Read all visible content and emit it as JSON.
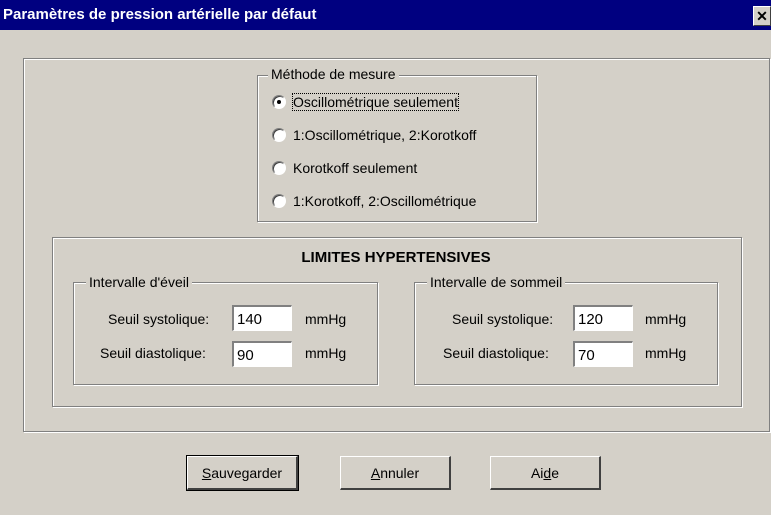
{
  "window": {
    "title": "Paramètres de pression artérielle par défaut",
    "close_label": "✕"
  },
  "method_group": {
    "legend": "Méthode de mesure",
    "options": [
      {
        "label": "Oscillométrique seulement",
        "selected": true
      },
      {
        "label": "1:Oscillométrique, 2:Korotkoff",
        "selected": false
      },
      {
        "label": "Korotkoff seulement",
        "selected": false
      },
      {
        "label": "1:Korotkoff, 2:Oscillométrique",
        "selected": false
      }
    ]
  },
  "limits": {
    "title": "LIMITES HYPERTENSIVES",
    "awake": {
      "legend": "Intervalle d'éveil",
      "systolic_label": "Seuil systolique:",
      "systolic_value": "140",
      "diastolic_label": "Seuil diastolique:",
      "diastolic_value": "90",
      "unit": "mmHg"
    },
    "sleep": {
      "legend": "Intervalle de sommeil",
      "systolic_label": "Seuil systolique:",
      "systolic_value": "120",
      "diastolic_label": "Seuil diastolique:",
      "diastolic_value": "70",
      "unit": "mmHg"
    }
  },
  "buttons": {
    "save": {
      "mnemonic": "S",
      "rest": "auvegarder"
    },
    "cancel": {
      "mnemonic": "A",
      "rest": "nnuler"
    },
    "help": {
      "pre": "Ai",
      "mnemonic": "d",
      "rest": "e"
    }
  }
}
